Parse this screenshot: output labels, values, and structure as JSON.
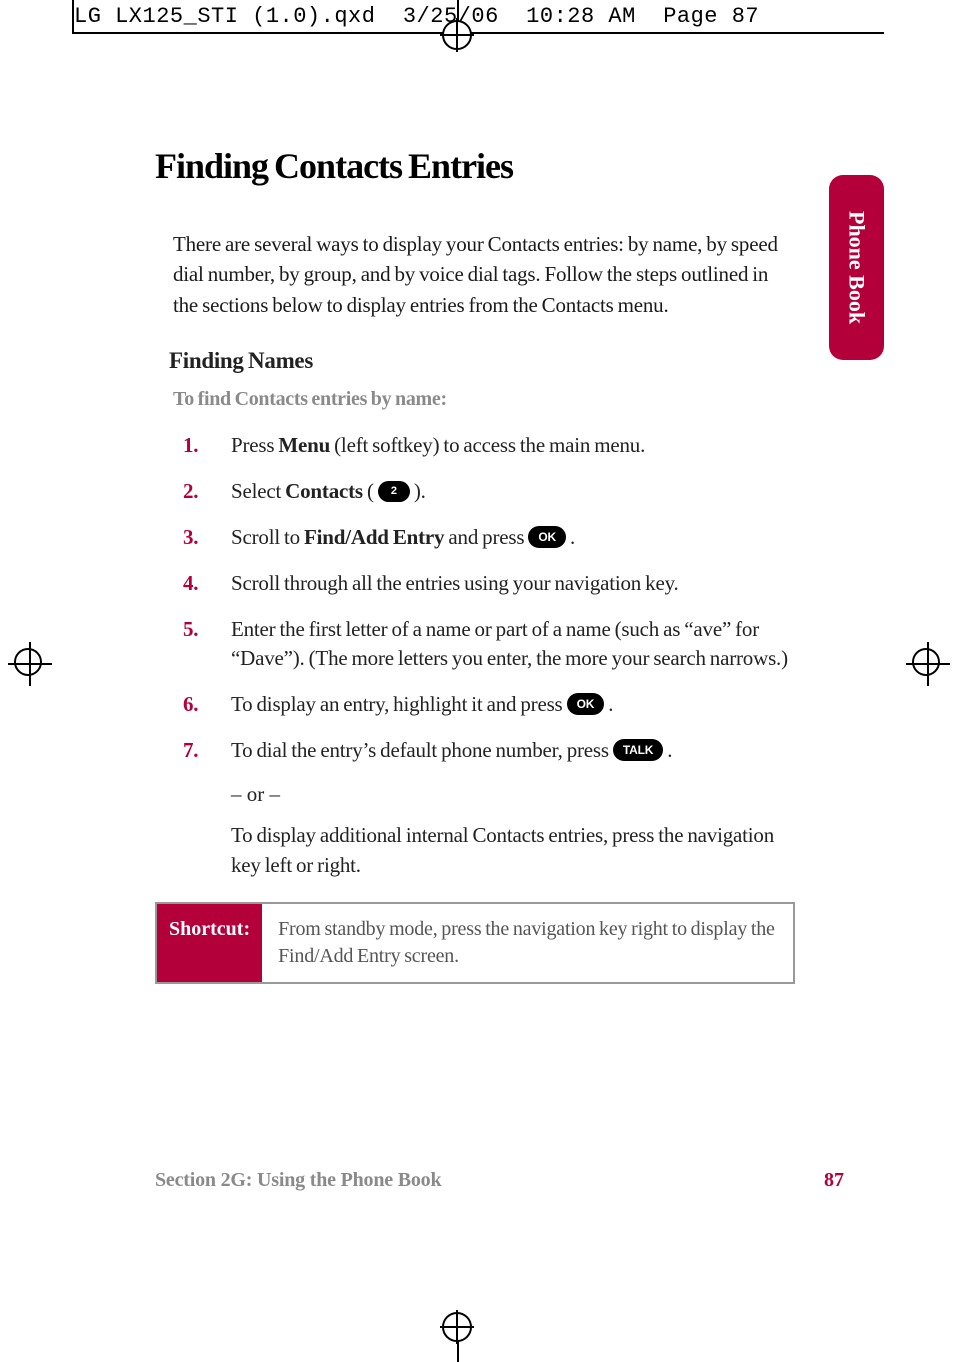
{
  "slug": "LG LX125_STI (1.0).qxd  3/25/06  10:28 AM  Page 87",
  "side_tab": "Phone Book",
  "title": "Finding Contacts Entries",
  "intro": "There are several ways to display your Contacts entries: by name, by speed dial number, by group, and by voice dial tags. Follow the steps outlined in the sections below to display entries from the Contacts menu.",
  "subhead": "Finding Names",
  "lead": "To find Contacts entries by name:",
  "steps": {
    "s1_a": "Press ",
    "s1_b": "Menu",
    "s1_c": " (left softkey) to access the main menu.",
    "s2_a": "Select ",
    "s2_b": "Contacts",
    "s2_c": " ( ",
    "s2_key": "2",
    "s2_d": " ).",
    "s3_a": "Scroll to ",
    "s3_b": "Find/Add Entry",
    "s3_c": " and press  ",
    "s3_key": "OK",
    "s3_d": " .",
    "s4": "Scroll through all the entries using your navigation key.",
    "s5": "Enter the first letter of a name or part of a name (such as “ave” for “Dave”). (The more letters you enter, the more your search narrows.)",
    "s6_a": "To display an entry, highlight it and press  ",
    "s6_key": "OK",
    "s6_b": " .",
    "s7_a": "To dial the entry’s default phone number, press  ",
    "s7_key": "TALK",
    "s7_b": " ."
  },
  "or": "– or –",
  "cont": "To display additional internal Contacts entries, press the navigation key left or right.",
  "shortcut_label": "Shortcut:",
  "shortcut_body": "From standby mode, press the navigation key right to display the Find/Add Entry screen.",
  "footer_left": "Section 2G: Using the Phone Book",
  "footer_right": "87",
  "nums": {
    "n1": "1.",
    "n2": "2.",
    "n3": "3.",
    "n4": "4.",
    "n5": "5.",
    "n6": "6.",
    "n7": "7."
  }
}
